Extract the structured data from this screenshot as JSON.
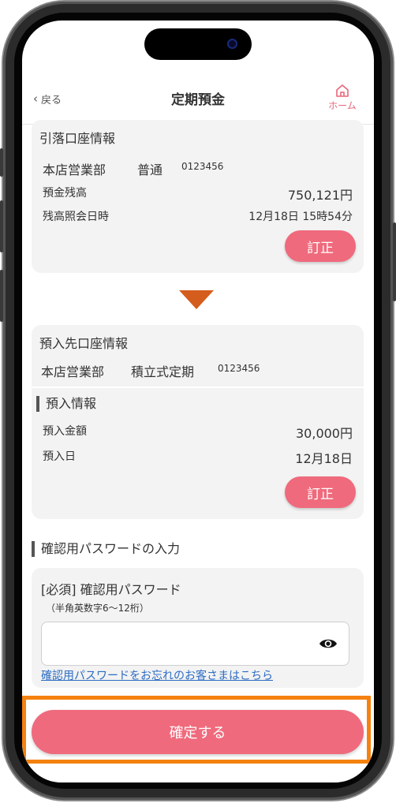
{
  "header": {
    "back_label": "戻る",
    "title": "定期預金",
    "home_label": "ホーム"
  },
  "withdrawal": {
    "title": "引落口座情報",
    "branch": "本店営業部",
    "type": "普通",
    "account_no": "0123456",
    "balance_label": "預金残高",
    "balance_value": "750,121円",
    "inquiry_label": "残高照会日時",
    "inquiry_value": "12月18日 15時54分",
    "correct_label": "訂正"
  },
  "deposit_account": {
    "title": "預入先口座情報",
    "branch": "本店営業部",
    "type": "積立式定期",
    "account_no": "0123456"
  },
  "deposit_info": {
    "title": "預入情報",
    "amount_label": "預入金額",
    "amount_value": "30,000円",
    "date_label": "預入日",
    "date_value": "12月18日",
    "correct_label": "訂正"
  },
  "password": {
    "section_title": "確認用パスワードの入力",
    "field_label": "[必須] 確認用パスワード",
    "field_hint": "（半角英数字6〜12桁）",
    "value": "",
    "placeholder": "",
    "forgot_link": "確認用パスワードをお忘れのお客さまはこちら"
  },
  "footer": {
    "confirm_label": "確定する"
  },
  "colors": {
    "accent": "#ef6a7c",
    "arrow": "#d45c1c",
    "highlight": "#f5820f",
    "link": "#2b6cc4"
  },
  "icons": {
    "back": "chevron-left-icon",
    "home": "home-icon",
    "eye": "eye-icon",
    "arrow": "triangle-down-icon"
  }
}
